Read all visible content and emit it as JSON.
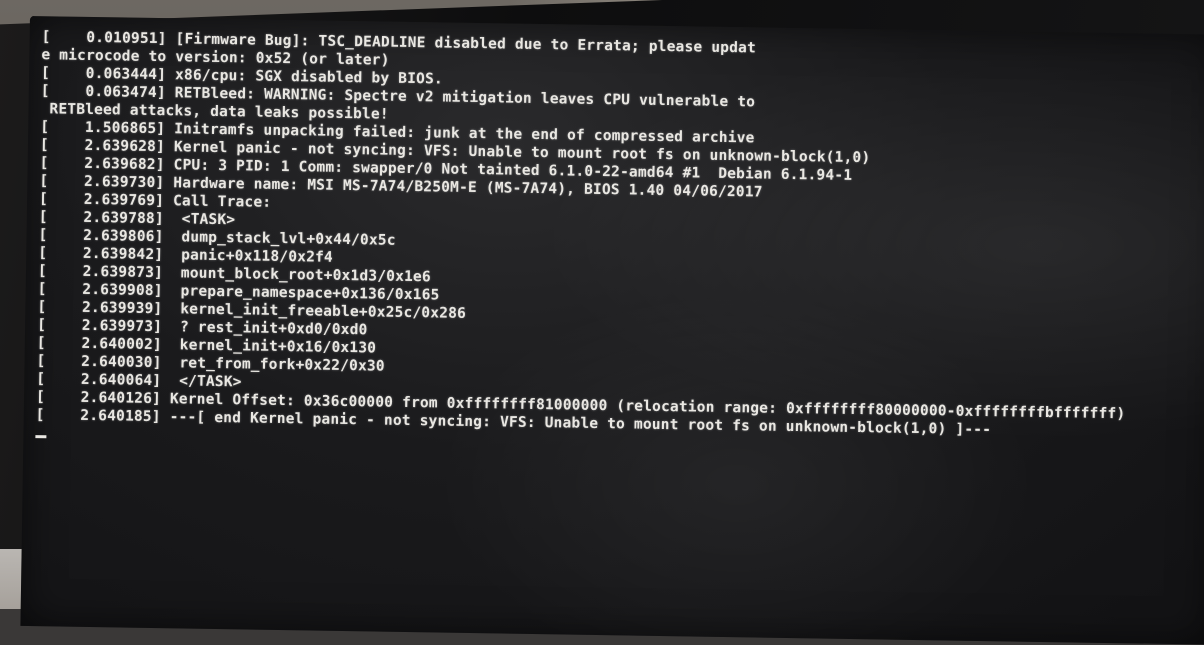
{
  "console": {
    "lines": [
      "[    0.010951] [Firmware Bug]: TSC_DEADLINE disabled due to Errata; please updat",
      "e microcode to version: 0x52 (or later)",
      "[    0.063444] x86/cpu: SGX disabled by BIOS.",
      "[    0.063474] RETBleed: WARNING: Spectre v2 mitigation leaves CPU vulnerable to",
      " RETBleed attacks, data leaks possible!",
      "[    1.506865] Initramfs unpacking failed: junk at the end of compressed archive",
      "[    2.639628] Kernel panic - not syncing: VFS: Unable to mount root fs on unknown-block(1,0)",
      "[    2.639682] CPU: 3 PID: 1 Comm: swapper/0 Not tainted 6.1.0-22-amd64 #1  Debian 6.1.94-1",
      "[    2.639730] Hardware name: MSI MS-7A74/B250M-E (MS-7A74), BIOS 1.40 04/06/2017",
      "[    2.639769] Call Trace:",
      "[    2.639788]  <TASK>",
      "[    2.639806]  dump_stack_lvl+0x44/0x5c",
      "[    2.639842]  panic+0x118/0x2f4",
      "[    2.639873]  mount_block_root+0x1d3/0x1e6",
      "[    2.639908]  prepare_namespace+0x136/0x165",
      "[    2.639939]  kernel_init_freeable+0x25c/0x286",
      "[    2.639973]  ? rest_init+0xd0/0xd0",
      "[    2.640002]  kernel_init+0x16/0x130",
      "[    2.640030]  ret_from_fork+0x22/0x30",
      "[    2.640064]  </TASK>",
      "[    2.640126] Kernel Offset: 0x36c00000 from 0xffffffff81000000 (relocation range: 0xffffffff80000000-0xffffffffbfffffff)",
      "[    2.640185] ---[ end Kernel panic - not syncing: VFS: Unable to mount root fs on unknown-block(1,0) ]---"
    ]
  }
}
